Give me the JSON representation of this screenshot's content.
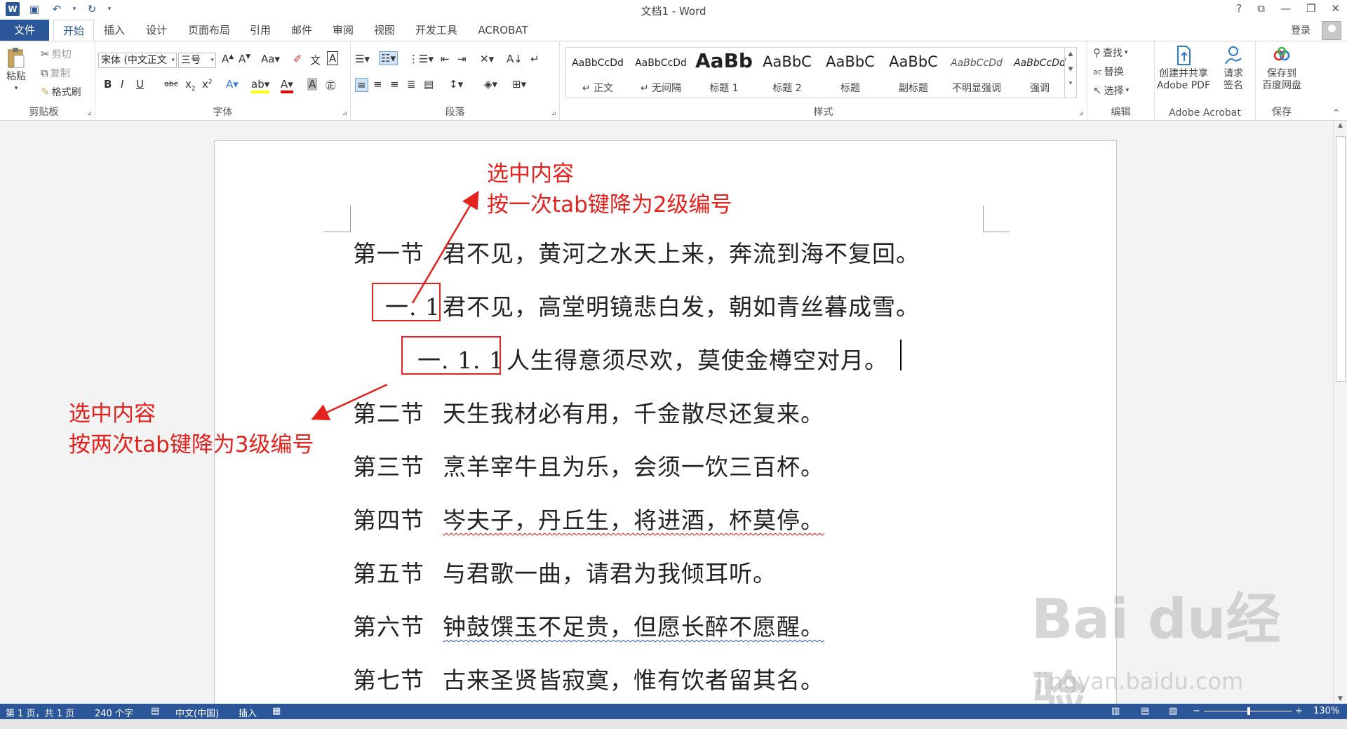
{
  "app": {
    "title": "文档1 - Word",
    "help": "?",
    "login": "登录"
  },
  "tabs": [
    {
      "label": "文件"
    },
    {
      "label": "开始"
    },
    {
      "label": "插入"
    },
    {
      "label": "设计"
    },
    {
      "label": "页面布局"
    },
    {
      "label": "引用"
    },
    {
      "label": "邮件"
    },
    {
      "label": "审阅"
    },
    {
      "label": "视图"
    },
    {
      "label": "开发工具"
    },
    {
      "label": "ACROBAT"
    }
  ],
  "clipboard": {
    "paste": "粘贴",
    "cut": "剪切",
    "copy": "复制",
    "format_painter": "格式刷",
    "label": "剪贴板"
  },
  "font": {
    "name": "宋体 (中文正文",
    "size": "三号",
    "label": "字体"
  },
  "paragraph": {
    "label": "段落"
  },
  "styles": {
    "label": "样式",
    "items": [
      {
        "preview": "AaBbCcDd",
        "name": "↵ 正文"
      },
      {
        "preview": "AaBbCcDd",
        "name": "↵ 无间隔"
      },
      {
        "preview": "AaBb",
        "name": "标题 1"
      },
      {
        "preview": "AaBbC",
        "name": "标题 2"
      },
      {
        "preview": "AaBbC",
        "name": "标题"
      },
      {
        "preview": "AaBbC",
        "name": "副标题"
      },
      {
        "preview": "AaBbCcDd",
        "name": "不明显强调"
      },
      {
        "preview": "AaBbCcDd",
        "name": "强调"
      }
    ]
  },
  "editing": {
    "find": "查找",
    "replace": "替换",
    "select": "选择",
    "label": "编辑"
  },
  "acrobat": {
    "create_share_line1": "创建并共享",
    "create_share_line2": "Adobe PDF",
    "request_sign_line1": "请求",
    "request_sign_line2": "签名",
    "label": "Adobe Acrobat"
  },
  "save_group": {
    "save_line1": "保存到",
    "save_line2": "百度网盘",
    "label": "保存"
  },
  "document": {
    "lines": [
      {
        "num": "第一节",
        "text": "君不见，黄河之水天上来，奔流到海不复回。"
      },
      {
        "num": "一. 1",
        "text": "君不见，高堂明镜悲白发，朝如青丝暮成雪。"
      },
      {
        "num": "一. 1. 1",
        "text": "人生得意须尽欢，莫使金樽空对月。"
      },
      {
        "num": "第二节",
        "text": "天生我材必有用，千金散尽还复来。"
      },
      {
        "num": "第三节",
        "text": "烹羊宰牛且为乐，会须一饮三百杯。"
      },
      {
        "num": "第四节",
        "text": "岑夫子，丹丘生，将进酒，杯莫停。"
      },
      {
        "num": "第五节",
        "text": "与君歌一曲，请君为我倾耳听。"
      },
      {
        "num": "第六节",
        "text": "钟鼓馔玉不足贵，但愿长醉不愿醒。"
      },
      {
        "num": "第七节",
        "text": "古来圣贤皆寂寞，惟有饮者留其名。"
      }
    ]
  },
  "annotations": {
    "top_line1": "选中内容",
    "top_line2": "按一次tab键降为2级编号",
    "left_line1": "选中内容",
    "left_line2": "按两次tab键降为3级编号",
    "color": "#e5211d"
  },
  "watermark": {
    "main": "Bai du经验",
    "sub": "jingyan.baidu.com"
  },
  "status": {
    "page": "第 1 页，共 1 页",
    "words": "240 个字",
    "lang": "中文(中国)",
    "mode": "插入",
    "zoom": "130%"
  },
  "colors": {
    "accent": "#2b579a"
  }
}
